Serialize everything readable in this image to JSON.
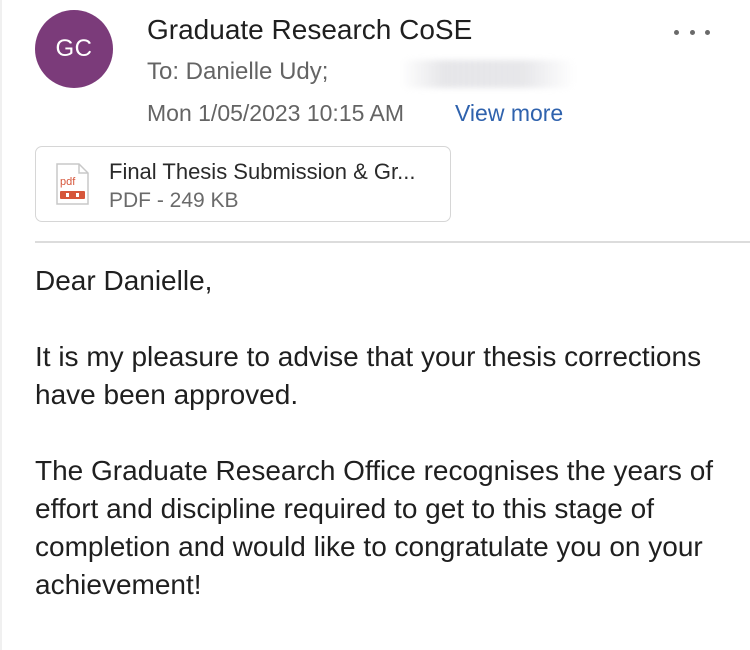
{
  "sender": {
    "initials": "GC",
    "name": "Graduate Research CoSE",
    "avatar_color": "#7b3b7a"
  },
  "recipients": {
    "label": "To: Danielle Udy;"
  },
  "meta": {
    "date": "Mon 1/05/2023 10:15 AM",
    "view_more": "View more"
  },
  "attachment": {
    "name": "Final Thesis Submission & Gr...",
    "meta": "PDF - 249 KB",
    "icon_label": "pdf",
    "icon": "pdf-file-icon"
  },
  "menu": {
    "icon": "more-options-icon"
  },
  "message": {
    "greeting": "Dear Danielle,",
    "paragraphs": [
      "It is my pleasure to advise that your thesis corrections have been approved.",
      "The Graduate Research Office recognises the years of effort and discipline required to get to this stage of completion and would like to congratulate you on your achievement!"
    ]
  },
  "colors": {
    "link": "#2f62ad",
    "pdf_accent": "#d6563b"
  }
}
